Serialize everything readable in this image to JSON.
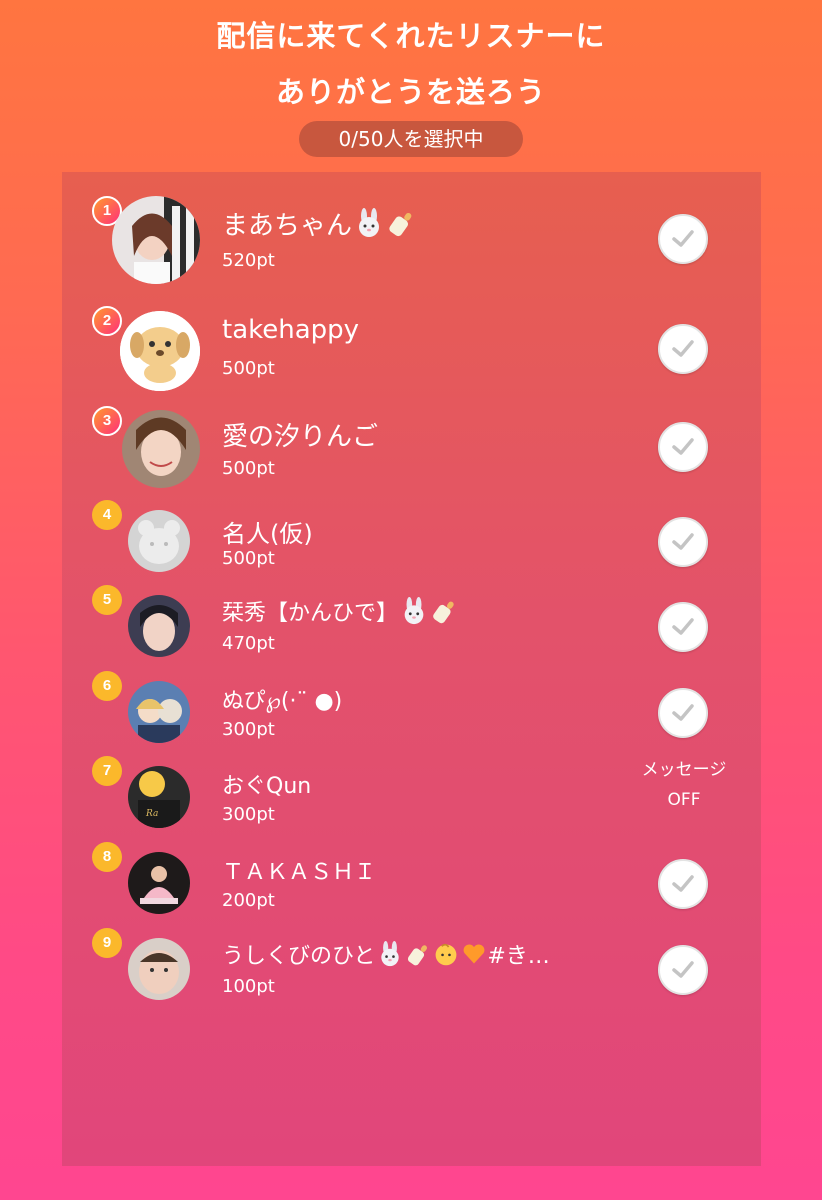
{
  "header": {
    "line1": "配信に来てくれたリスナーに",
    "line2": "ありがとうを送ろう",
    "counter": "0/50人を選択中"
  },
  "listeners": [
    {
      "rank": "1",
      "name": "まあちゃん",
      "points": "520pt",
      "emojis": [
        "rabbit-icon",
        "baby-bottle-icon"
      ]
    },
    {
      "rank": "2",
      "name": "takehappy",
      "points": "500pt",
      "emojis": []
    },
    {
      "rank": "3",
      "name": "愛の汐りんご",
      "points": "500pt",
      "emojis": []
    },
    {
      "rank": "4",
      "name": "名人(仮)",
      "points": "500pt",
      "emojis": []
    },
    {
      "rank": "5",
      "name": "栞秀【かんひで】",
      "points": "470pt",
      "emojis": [
        "rabbit-icon",
        "baby-bottle-icon"
      ]
    },
    {
      "rank": "6",
      "name": "ぬぴ℘(·¨ ●)",
      "points": "300pt",
      "emojis": []
    },
    {
      "rank": "7",
      "name": "おぐQun",
      "points": "300pt",
      "emojis": [],
      "message_status": [
        "メッセージ",
        "OFF"
      ]
    },
    {
      "rank": "8",
      "name": "ＴＡＫＡＳＨＩ",
      "points": "200pt",
      "emojis": []
    },
    {
      "rank": "9",
      "name": "うしくびのひと",
      "name_suffix": "#き…",
      "points": "100pt",
      "emojis": [
        "rabbit-icon",
        "baby-bottle-icon",
        "baby-face-icon",
        "orange-heart-icon"
      ]
    }
  ],
  "colors": {
    "background_top": "#ff7540",
    "background_bottom": "#ff4690",
    "panel": "#e3526a",
    "counter_pill": "#c8573e",
    "rank_gold": "#fbb82b",
    "check_gray": "#c4c4c4"
  }
}
